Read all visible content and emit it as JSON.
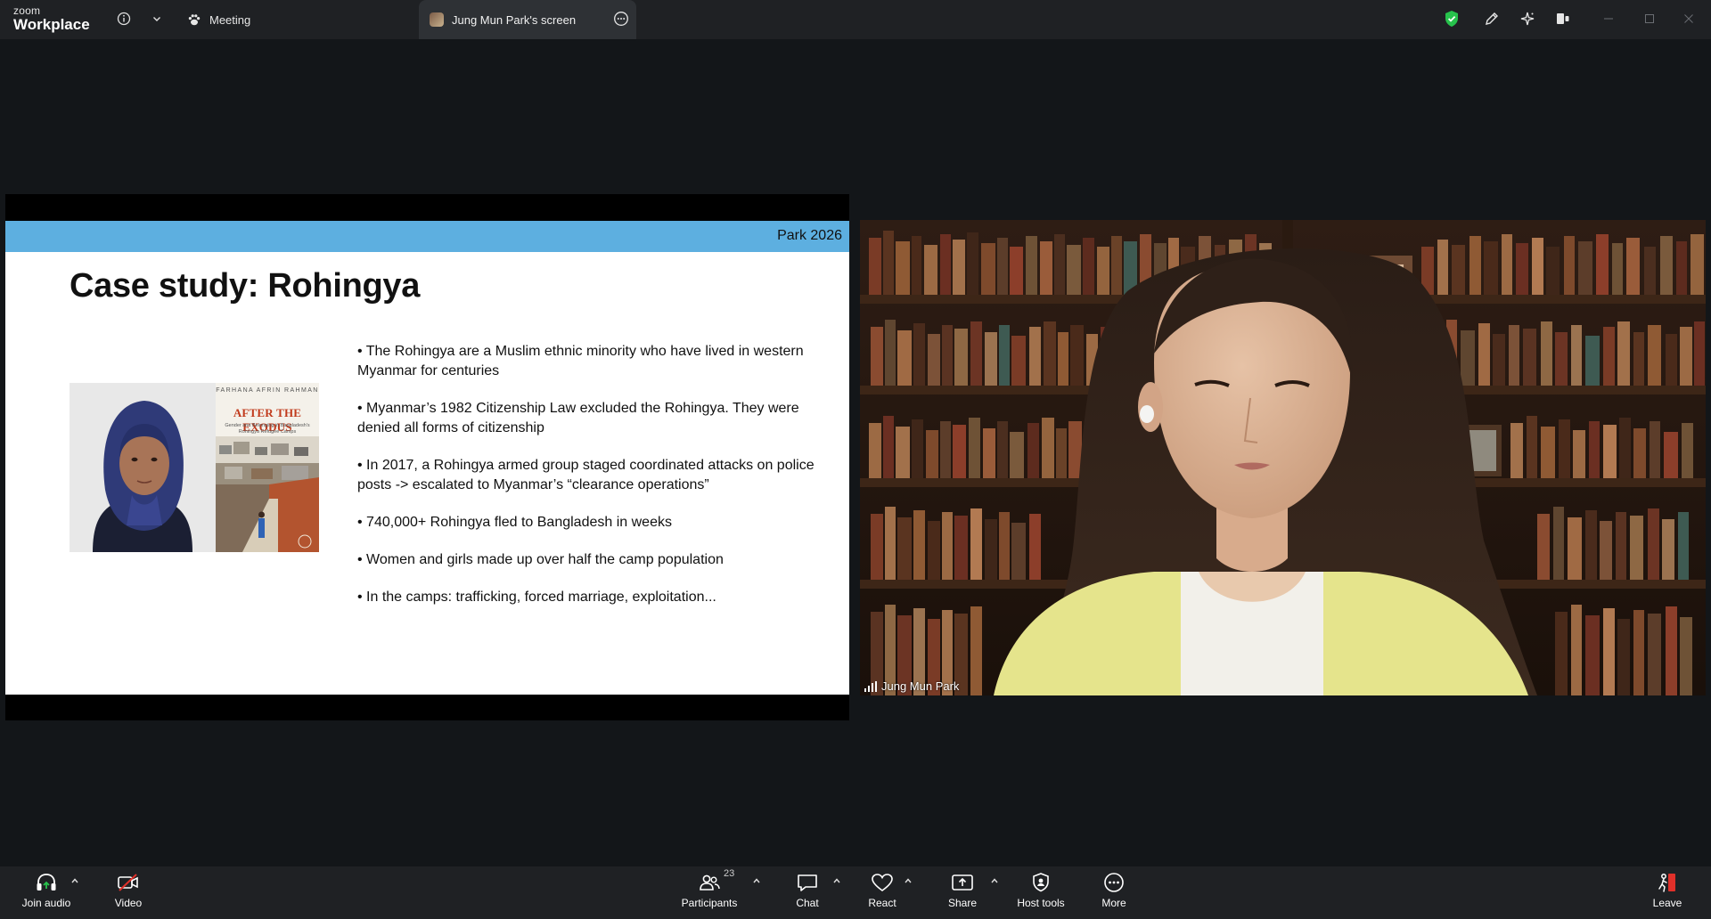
{
  "titlebar": {
    "brand_small": "zoom",
    "brand_large": "Workplace",
    "meeting_tab_label": "Meeting",
    "screen_tab_label": "Jung Mun Park's screen"
  },
  "slide": {
    "credit": "Park 2026",
    "title": "Case study: Rohingya",
    "book_author": "FARHANA AFRIN RAHMAN",
    "book_title": "AFTER THE EXODUS",
    "book_subtitle": "Gender and Belonging in Bangladesh's Rohingya Refugee Camps",
    "bullets": [
      "•  The Rohingya are a Muslim ethnic minority who have lived in western Myanmar for centuries",
      "•  Myanmar’s 1982 Citizenship Law excluded the Rohingya. They were denied all forms of citizenship",
      "•  In 2017, a Rohingya armed group staged coordinated attacks on police posts -> escalated to Myanmar’s “clearance operations”",
      "•  740,000+ Rohingya fled to Bangladesh in weeks",
      "•  Women and girls made up over half the camp population",
      "•  In the camps: trafficking, forced marriage, exploitation..."
    ]
  },
  "video": {
    "participant_name": "Jung Mun Park"
  },
  "toolbar": {
    "join_audio": "Join audio",
    "video": "Video",
    "participants": "Participants",
    "participants_count": "23",
    "chat": "Chat",
    "react": "React",
    "share": "Share",
    "host_tools": "Host tools",
    "more": "More",
    "leave": "Leave"
  },
  "colors": {
    "slide_header": "#5dafe0",
    "security_shield": "#27c24c",
    "leave_accent": "#e0302a",
    "video_off": "#e0302a"
  }
}
